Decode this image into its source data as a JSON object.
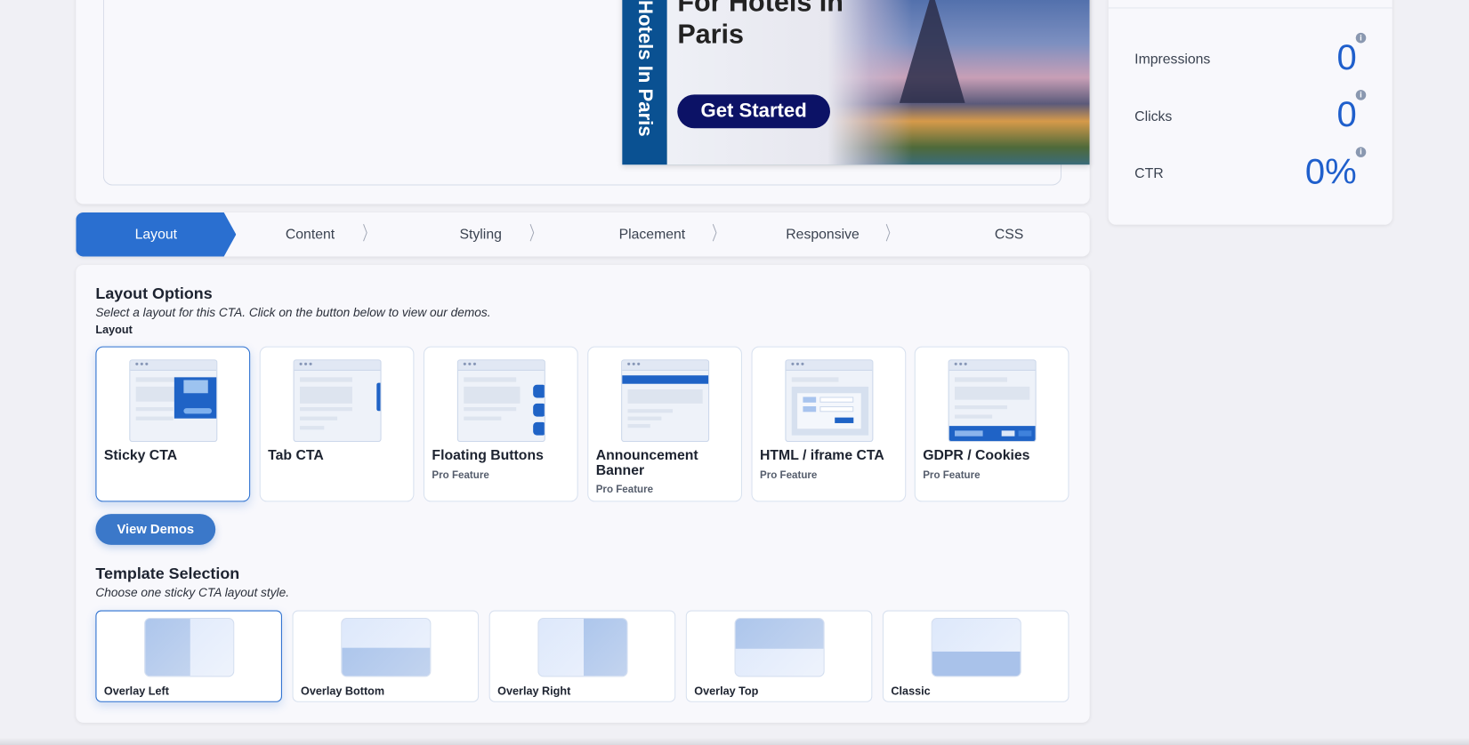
{
  "banner": {
    "vertical_text": "Hotels In Paris",
    "headline": "For Hotels In Paris",
    "cta": "Get Started"
  },
  "stats": [
    {
      "label": "Impressions",
      "value": "0"
    },
    {
      "label": "Clicks",
      "value": "0"
    },
    {
      "label": "CTR",
      "value": "0%"
    }
  ],
  "info_glyph": "i",
  "tabs": [
    "Layout",
    "Content",
    "Styling",
    "Placement",
    "Responsive",
    "CSS"
  ],
  "layout_options": {
    "title": "Layout Options",
    "subtitle": "Select a layout for this CTA. Click on the button below to view our demos.",
    "field_label": "Layout",
    "cards": [
      {
        "title": "Sticky CTA",
        "badge": ""
      },
      {
        "title": "Tab CTA",
        "badge": ""
      },
      {
        "title": "Floating Buttons",
        "badge": "Pro Feature"
      },
      {
        "title": "Announcement Banner",
        "badge": "Pro Feature"
      },
      {
        "title": "HTML / iframe CTA",
        "badge": "Pro Feature"
      },
      {
        "title": "GDPR / Cookies",
        "badge": "Pro Feature"
      }
    ],
    "view_demos": "View Demos"
  },
  "template_selection": {
    "title": "Template Selection",
    "subtitle": "Choose one sticky CTA layout style.",
    "templates": [
      "Overlay Left",
      "Overlay Bottom",
      "Overlay Right",
      "Overlay Top",
      "Classic"
    ]
  },
  "colors": {
    "accent": "#2a6fd0",
    "button": "#3b78c9",
    "stat_value": "#1f5fcc",
    "banner_strip": "#0a5192",
    "banner_cta": "#0c1266"
  }
}
